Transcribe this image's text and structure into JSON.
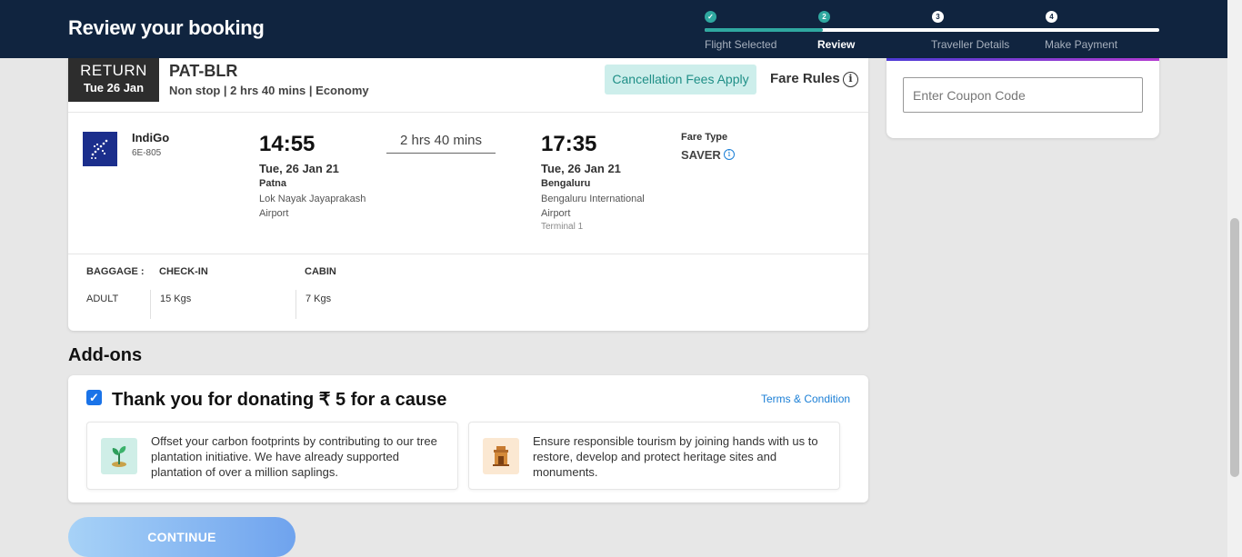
{
  "header": {
    "title": "Review your booking",
    "steps": [
      {
        "num": "✓",
        "label": "Flight Selected"
      },
      {
        "num": "2",
        "label": "Review"
      },
      {
        "num": "3",
        "label": "Traveller Details"
      },
      {
        "num": "4",
        "label": "Make Payment"
      }
    ]
  },
  "flight": {
    "badge_type": "RETURN",
    "badge_date": "Tue 26 Jan",
    "route": "PAT-BLR",
    "route_details": "Non stop | 2 hrs 40 mins | Economy",
    "cancellation": "Cancellation Fees Apply",
    "fare_rules": "Fare Rules",
    "airline": "IndiGo",
    "flight_number": "6E-805",
    "departure": {
      "time": "14:55",
      "date": "Tue, 26 Jan 21",
      "city": "Patna",
      "airport": "Lok Nayak Jayaprakash Airport"
    },
    "duration": "2 hrs 40 mins",
    "arrival": {
      "time": "17:35",
      "date": "Tue, 26 Jan 21",
      "city": "Bengaluru",
      "airport": "Bengaluru International Airport",
      "terminal": "Terminal 1"
    },
    "fare_type_label": "Fare Type",
    "fare_type": "SAVER",
    "baggage": {
      "label": "BAGGAGE :",
      "checkin_header": "CHECK-IN",
      "cabin_header": "CABIN",
      "passenger": "ADULT",
      "checkin": "15 Kgs",
      "cabin": "7 Kgs"
    }
  },
  "coupon": {
    "placeholder": "Enter Coupon Code"
  },
  "addons": {
    "title": "Add-ons",
    "donate_text": "Thank you for donating ₹ 5 for a cause",
    "terms": "Terms & Condition",
    "cards": [
      {
        "icon": "plant-icon",
        "text": "Offset your carbon footprints by contributing to our tree plantation initiative. We have already supported plantation of over a million saplings."
      },
      {
        "icon": "monument-icon",
        "text": "Ensure responsible tourism by joining hands with us to restore, develop and protect heritage sites and monuments."
      }
    ]
  },
  "continue_label": "CONTINUE",
  "colors": {
    "header_bg": "#10243f",
    "accent_teal": "#2fa8a0",
    "link_blue": "#1b7fd6",
    "checkbox_blue": "#1a73e8"
  }
}
